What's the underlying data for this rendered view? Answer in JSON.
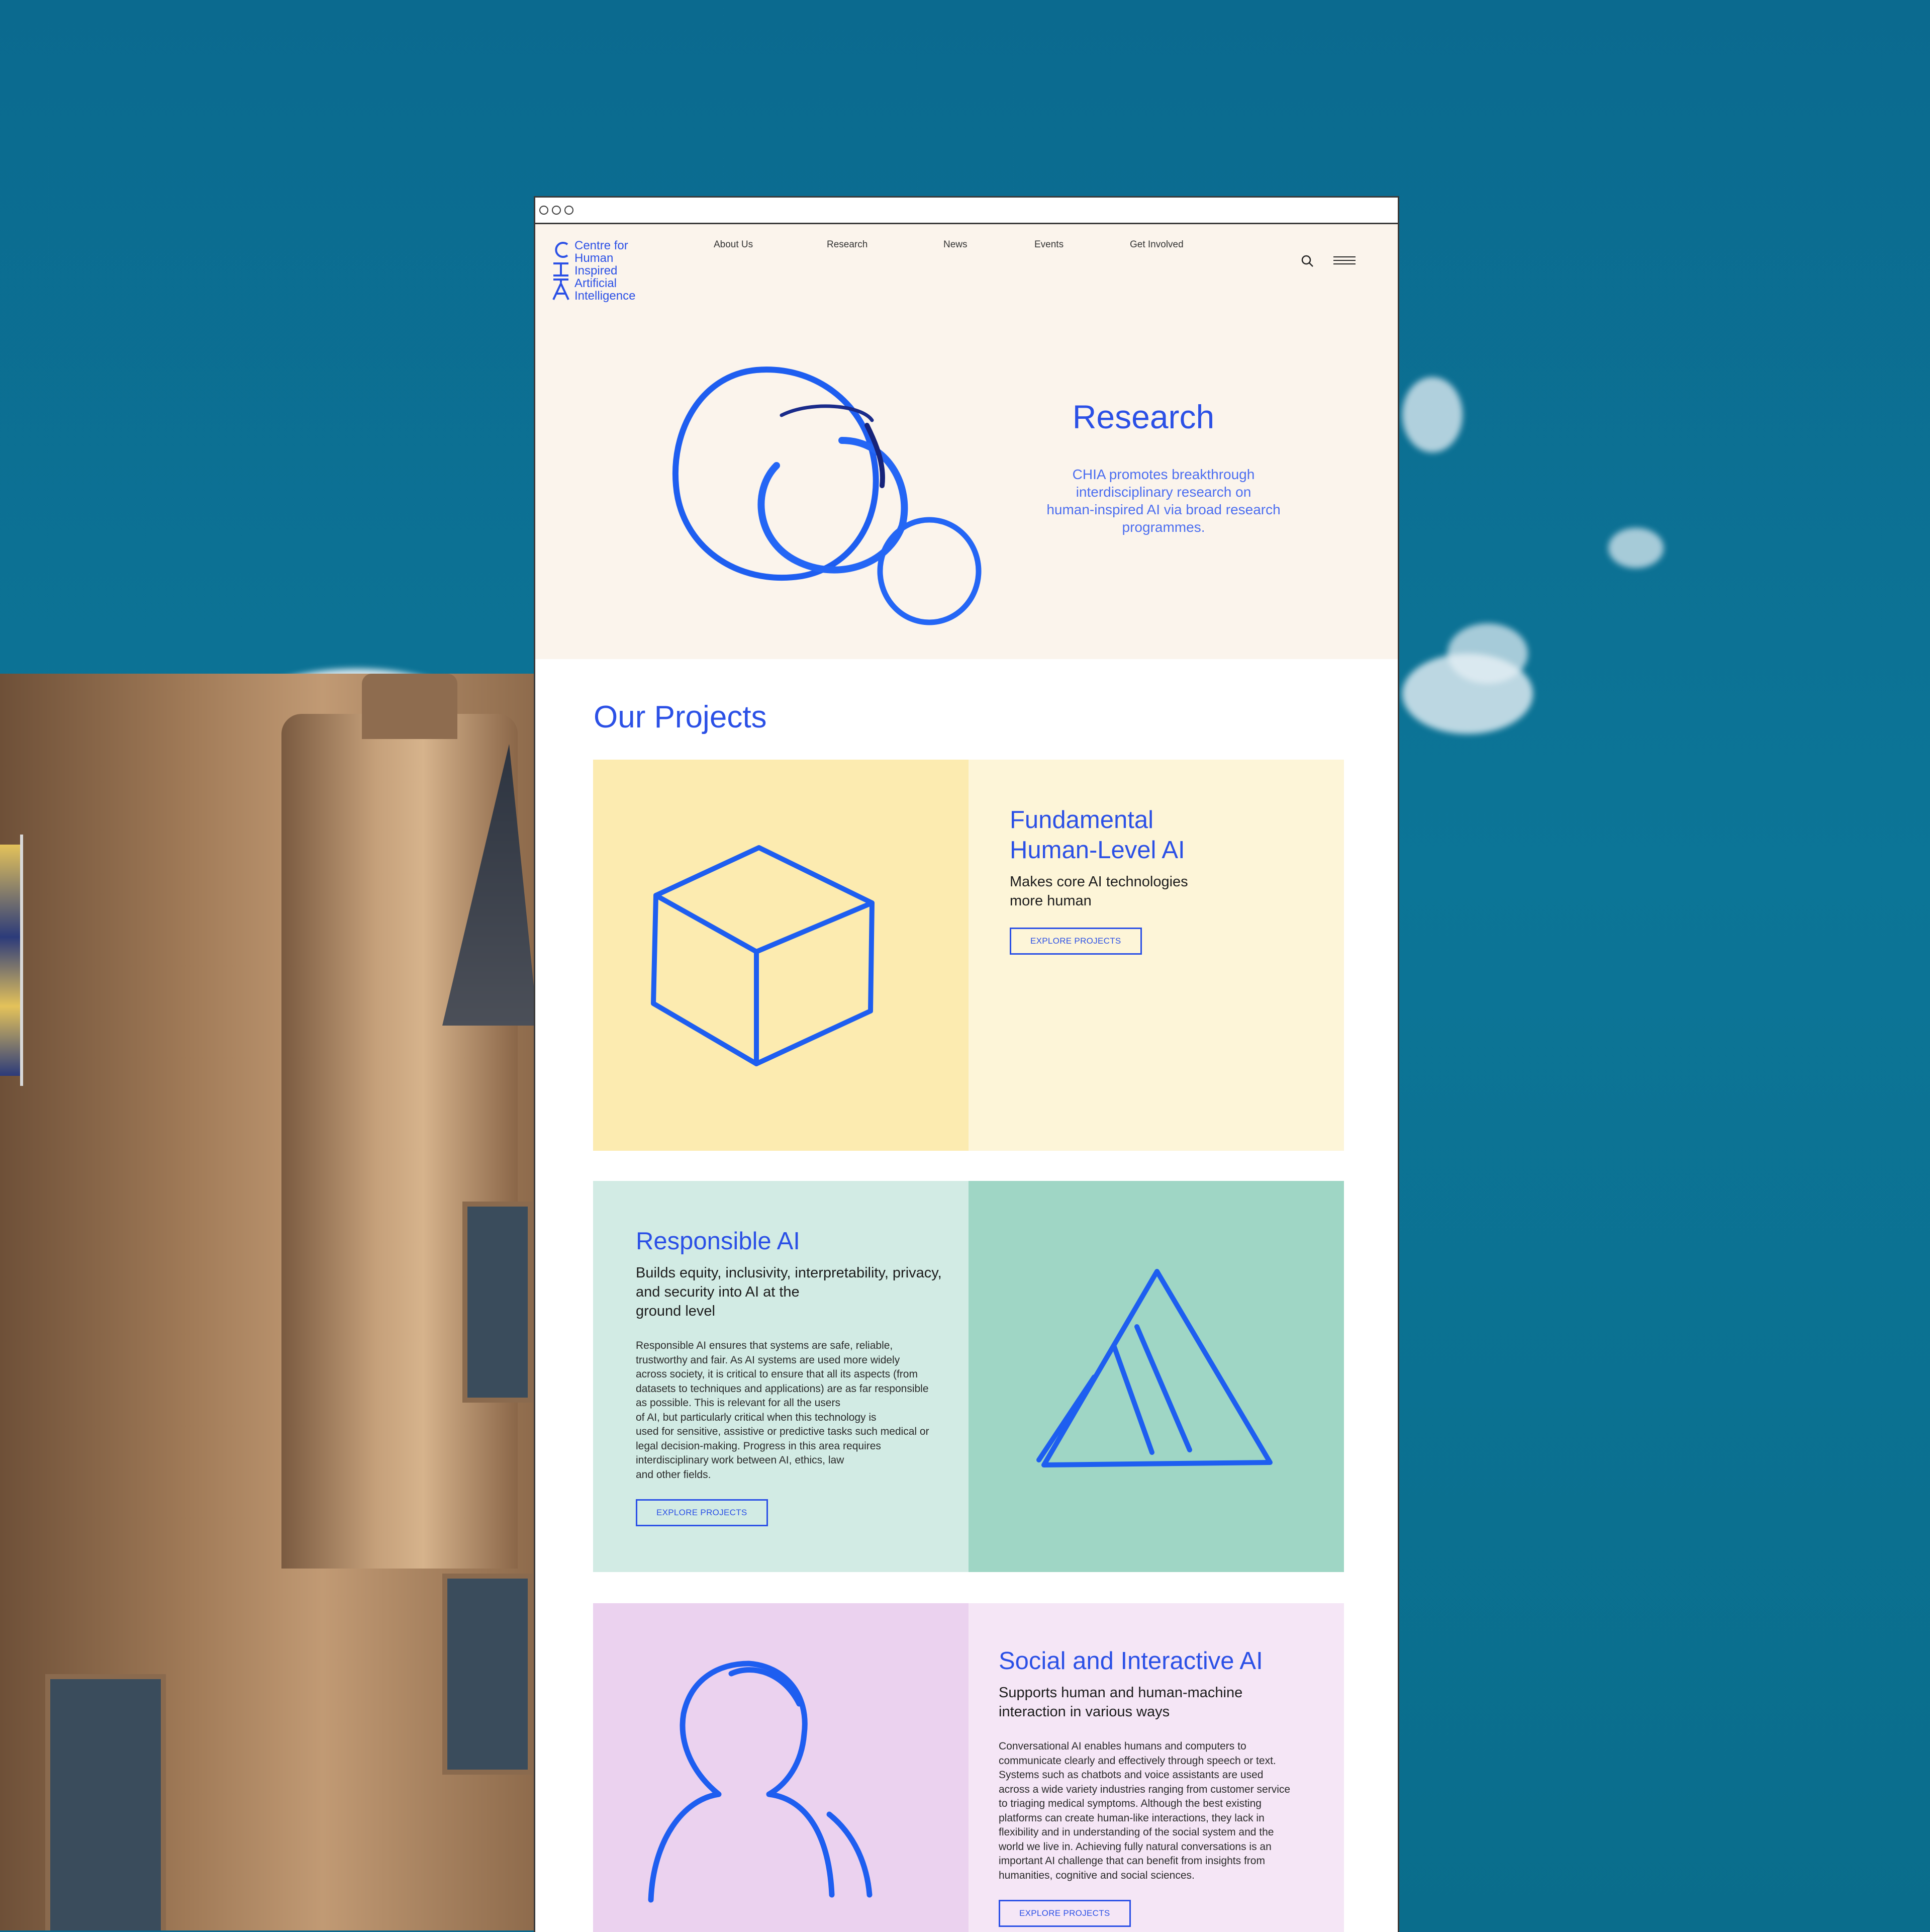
{
  "window": {
    "controls": [
      "close",
      "minimize",
      "maximize"
    ]
  },
  "logo": {
    "letters": "CHIA",
    "lines": [
      "Centre for",
      "Human",
      "Inspired",
      "Artificial",
      "Intelligence"
    ]
  },
  "nav": {
    "items": [
      "About Us",
      "Research",
      "News",
      "Events",
      "Get Involved"
    ],
    "search_icon": "search-icon",
    "menu_icon": "hamburger-menu-icon"
  },
  "hero": {
    "title": "Research",
    "description_lines": [
      "CHIA promotes breakthrough",
      "interdisciplinary research on",
      "human-inspired AI via broad research",
      "programmes."
    ],
    "illustration": "overlapping-circles-sketch"
  },
  "projects": {
    "heading": "Our Projects",
    "cards": [
      {
        "title_lines": [
          "Fundamental",
          "Human-Level AI"
        ],
        "subtitle_lines": [
          "Makes core AI technologies",
          "more human"
        ],
        "button": "EXPLORE PROJECTS",
        "illustration": "cube-sketch",
        "colors": {
          "art_bg": "#fcebb0",
          "text_bg": "#fdf5d8"
        }
      },
      {
        "title_lines": [
          "Responsible AI"
        ],
        "subtitle_lines": [
          "Builds equity, inclusivity, interpretability, privacy,",
          "and security into AI at the",
          "ground level"
        ],
        "body_lines": [
          "Responsible AI ensures that systems are safe, reliable,",
          "trustworthy and fair. As AI systems are used more widely",
          "across society, it is critical to ensure that all its aspects (from",
          "datasets to techniques and applications) are as far responsible",
          "as possible. This is relevant for all the users",
          "of AI, but particularly critical when this technology is",
          "used for sensitive, assistive or predictive tasks such medical or",
          "legal decision-making. Progress in this area requires",
          "interdisciplinary work between AI, ethics, law",
          "and other fields."
        ],
        "button": "EXPLORE PROJECTS",
        "illustration": "triangle-sketch",
        "colors": {
          "text_bg": "#d2ebe4",
          "art_bg": "#9fd6c5"
        }
      },
      {
        "title_lines": [
          "Social and Interactive AI"
        ],
        "subtitle_lines": [
          "Supports human and human-machine",
          "interaction in various ways"
        ],
        "body_lines": [
          "Conversational AI enables humans and computers to",
          "communicate clearly and effectively through speech or text.",
          "Systems such as chatbots and voice assistants are used",
          "across a wide variety industries ranging from customer service",
          "to triaging medical symptoms. Although the best existing",
          "platforms can create human-like interactions, they lack in",
          "flexibility and in understanding of the social system and the",
          "world we live in. Achieving fully natural conversations is an",
          "important AI challenge that can benefit from insights from",
          "humanities, cognitive and social sciences."
        ],
        "button": "EXPLORE PROJECTS",
        "illustration": "person-sketch",
        "colors": {
          "art_bg": "#ebd2ef",
          "text_bg": "#f5e6f6"
        }
      }
    ]
  },
  "colors": {
    "accent": "#2b50e6",
    "hero_bg": "#fbf4ec"
  }
}
